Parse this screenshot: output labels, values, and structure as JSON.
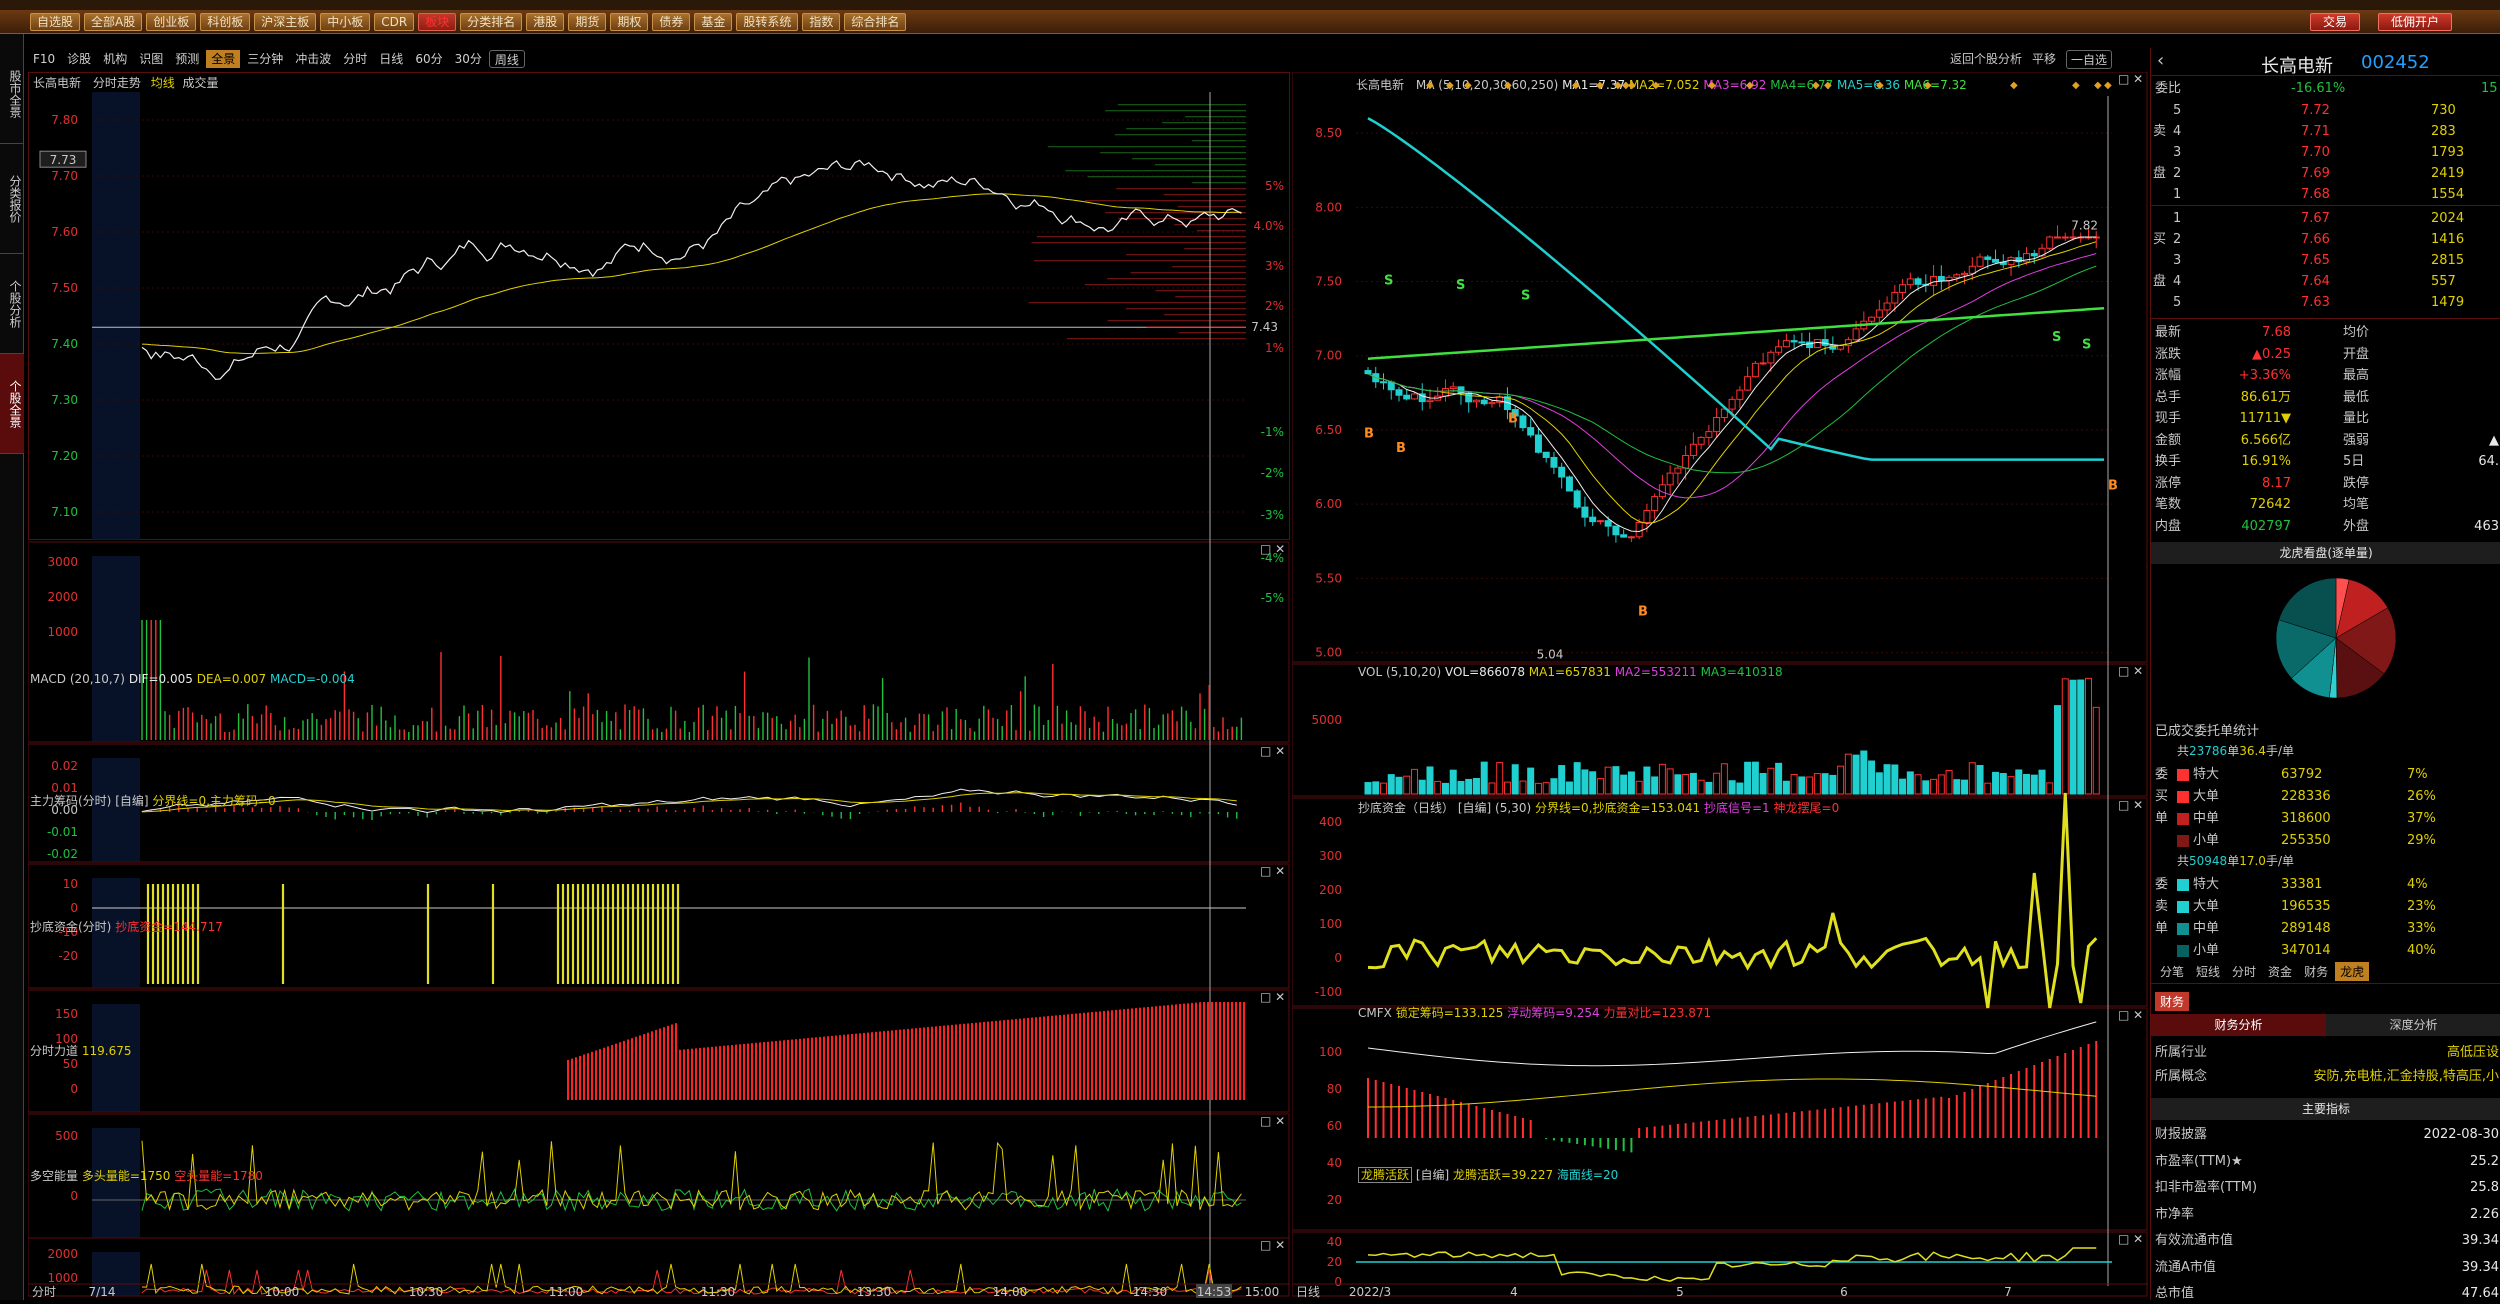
{
  "toolbar": {
    "buttons": [
      "自选股",
      "全部A股",
      "创业板",
      "科创板",
      "沪深主板",
      "中小板",
      "CDR",
      "板块",
      "分类排名",
      "港股",
      "期货",
      "期权",
      "债券",
      "基金",
      "股转系统",
      "指数",
      "综合排名"
    ],
    "trade": "交易",
    "open_account": "低佣开户"
  },
  "left_tabs": [
    "股市全景",
    "分类报价",
    "个股分析",
    "个股全景"
  ],
  "subbar": {
    "items": [
      "F10",
      "诊股",
      "机构",
      "识图",
      "预测",
      "全景",
      "三分钟",
      "冲击波",
      "分时",
      "日线",
      "60分",
      "30分",
      "周线"
    ],
    "active": "全景",
    "right_items": [
      "返回个股分析",
      "平移",
      "一自选"
    ]
  },
  "intraday": {
    "title": "长高电新",
    "subtitle": "分时走势",
    "avg_label": "均线",
    "vol_label": "成交量",
    "price_ticks": [
      "7.80",
      "7.70",
      "7.60",
      "7.50",
      "7.40",
      "7.30",
      "7.20",
      "7.10"
    ],
    "pct_ticks": [
      "5%",
      "4.0%",
      "3%",
      "2%",
      "1%",
      "-1%",
      "-2%",
      "-3%",
      "-4%",
      "-5%"
    ],
    "current_price_tag": "7.73",
    "mid_value": "7.43",
    "vol_ticks": [
      "3000",
      "2000",
      "1000"
    ],
    "macd_title": "MACD",
    "macd_params": "(20,10,7)",
    "macd_dif": "DIF=0.005",
    "macd_dea": "DEA=0.007",
    "macd_macd": "MACD=-0.004",
    "macd_ticks": [
      "0.02",
      "0.01",
      "0.00",
      "-0.01",
      "-0.02"
    ],
    "zl_title": "主力筹码(分时)",
    "zl_tag": "[自编]",
    "zl_values": "分界线=0,主力筹码=0",
    "zl_ticks": [
      "10",
      "0",
      "-10",
      "-20"
    ],
    "cd_title": "抄底资金(分时)",
    "cd_tag": "[自编]",
    "cd_value": "抄底资金=144.717",
    "cd_ticks": [
      "150",
      "100",
      "50",
      "0"
    ],
    "fs_title": "分时力道",
    "fs_value": "119.675",
    "fs_ticks": [
      "500",
      "0"
    ],
    "dk_title": "多空能量",
    "dk_value1": "多头量能=1750",
    "dk_value2": "空头量能=1780",
    "dk_ticks": [
      "2000",
      "1000"
    ],
    "time_labels": [
      "7/14",
      "10:00",
      "10:30",
      "11:00",
      "11:30",
      "13:30",
      "14:00",
      "14:30",
      "14:53",
      "15:00"
    ],
    "footer_left": "分时"
  },
  "daily": {
    "title": "长高电新",
    "ma_label": "MA",
    "ma_params": "(5,10,20,30,60,250)",
    "ma1": "MA1=7.37",
    "ma2": "MA2=7.052",
    "ma3": "MA3=6.92",
    "ma4": "MA4=6.77",
    "ma5": "MA5=6.36",
    "ma6": "MA6=7.32",
    "price_ticks": [
      "8.50",
      "8.00",
      "7.50",
      "7.00",
      "6.50",
      "6.00",
      "5.50",
      "5.00"
    ],
    "high_label": "7.82",
    "low_label": "5.04",
    "vol_title": "VOL",
    "vol_params": "(5,10,20)",
    "vol_value": "VOL=866078",
    "vol_ma1": "MA1=657831",
    "vol_ma2": "MA2=553211",
    "vol_ma3": "MA3=410318",
    "vol_ticks": [
      "5000"
    ],
    "cd_title": "抄底资金（日线）",
    "cd_tag": "[自编]",
    "cd_params": "(5,30)",
    "cd_values": "分界线=0,抄底资金=153.041",
    "cd_signal": "抄底信号=1",
    "cd_dragon": "神龙摆尾=0",
    "cd_ticks": [
      "400",
      "300",
      "200",
      "100",
      "0",
      "-100"
    ],
    "cmfx_title": "CMFX",
    "cmfx_lock": "锁定筹码=133.125",
    "cmfx_float": "浮动筹码=9.254",
    "cmfx_ratio": "力量对比=123.871",
    "cmfx_ticks": [
      "100",
      "80",
      "60",
      "40",
      "20"
    ],
    "lt_title": "龙腾活跃",
    "lt_tag": "[自编]",
    "lt_value": "龙腾活跃=39.227",
    "lt_sea": "海面线=20",
    "lt_ticks": [
      "40",
      "20",
      "0"
    ],
    "date_labels": [
      "2022/3",
      "4",
      "5",
      "6",
      "7"
    ],
    "footer_left": "日线"
  },
  "quote": {
    "name": "长高电新",
    "code": "002452",
    "wb_label": "委比",
    "wb_value": "-16.61%",
    "wb_extra": "15",
    "sell_side": "卖",
    "buy_side": "买",
    "pan": "盘",
    "sell": [
      {
        "lvl": "5",
        "price": "7.72",
        "vol": "730"
      },
      {
        "lvl": "4",
        "price": "7.71",
        "vol": "283"
      },
      {
        "lvl": "3",
        "price": "7.70",
        "vol": "1793"
      },
      {
        "lvl": "2",
        "price": "7.69",
        "vol": "2419"
      },
      {
        "lvl": "1",
        "price": "7.68",
        "vol": "1554"
      }
    ],
    "buy": [
      {
        "lvl": "1",
        "price": "7.67",
        "vol": "2024"
      },
      {
        "lvl": "2",
        "price": "7.66",
        "vol": "1416"
      },
      {
        "lvl": "3",
        "price": "7.65",
        "vol": "2815"
      },
      {
        "lvl": "4",
        "price": "7.64",
        "vol": "557"
      },
      {
        "lvl": "5",
        "price": "7.63",
        "vol": "1479"
      }
    ],
    "stats": [
      {
        "k1": "最新",
        "v1": "7.68",
        "k2": "均价",
        "v2": "",
        "c1": "red"
      },
      {
        "k1": "涨跌",
        "v1": "▲0.25",
        "k2": "开盘",
        "v2": "",
        "c1": "red"
      },
      {
        "k1": "涨幅",
        "v1": "+3.36%",
        "k2": "最高",
        "v2": "",
        "c1": "red"
      },
      {
        "k1": "总手",
        "v1": "86.61万",
        "k2": "最低",
        "v2": "",
        "c1": "yellow"
      },
      {
        "k1": "现手",
        "v1": "11711▼",
        "k2": "量比",
        "v2": "",
        "c1": "yellow"
      },
      {
        "k1": "金额",
        "v1": "6.566亿",
        "k2": "强弱",
        "v2": "▲",
        "c1": "yellow"
      },
      {
        "k1": "换手",
        "v1": "16.91%",
        "k2": "5日",
        "v2": "64.",
        "c1": "yellow"
      },
      {
        "k1": "涨停",
        "v1": "8.17",
        "k2": "跌停",
        "v2": "",
        "c1": "red"
      },
      {
        "k1": "笔数",
        "v1": "72642",
        "k2": "均笔",
        "v2": "",
        "c1": "yellow"
      },
      {
        "k1": "内盘",
        "v1": "402797",
        "k2": "外盘",
        "v2": "463",
        "c1": "green"
      }
    ],
    "pie_title": "龙虎看盘(逐单量)",
    "order_title": "已成交委托单统计",
    "buy_group_head_a": "共",
    "buy_group_count": "23786",
    "buy_group_head_b": "单",
    "buy_group_avg": "36.4",
    "buy_group_unit": "手/单",
    "sell_group_count": "50948",
    "sell_group_avg": "17.0",
    "buy_side_label": [
      "委",
      "买",
      "单"
    ],
    "sell_side_label": [
      "委",
      "卖",
      "单"
    ],
    "buy_orders": [
      {
        "name": "特大",
        "vol": "63792",
        "pct": "7%"
      },
      {
        "name": "大单",
        "vol": "228336",
        "pct": "26%"
      },
      {
        "name": "中单",
        "vol": "318600",
        "pct": "37%"
      },
      {
        "name": "小单",
        "vol": "255350",
        "pct": "29%"
      }
    ],
    "sell_orders": [
      {
        "name": "特大",
        "vol": "33381",
        "pct": "4%"
      },
      {
        "name": "大单",
        "vol": "196535",
        "pct": "23%"
      },
      {
        "name": "中单",
        "vol": "289148",
        "pct": "33%"
      },
      {
        "name": "小单",
        "vol": "347014",
        "pct": "40%"
      }
    ],
    "tabs": [
      "分笔",
      "短线",
      "分时",
      "资金",
      "财务",
      "龙虎"
    ],
    "active_tab": "龙虎",
    "fin_tab": "财务",
    "fin_sub": [
      "财务分析",
      "深度分析"
    ],
    "info": [
      {
        "k": "所属行业",
        "v": "高低压设"
      },
      {
        "k": "所属概念",
        "v": "安防,充电桩,汇金持股,特高压,小"
      }
    ],
    "key_title": "主要指标",
    "metrics": [
      {
        "k": "财报披露",
        "v": "2022-08-30"
      },
      {
        "k": "市盈率(TTM)★",
        "v": "25.2"
      },
      {
        "k": "扣非市盈率(TTM)",
        "v": "25.8"
      },
      {
        "k": "市净率",
        "v": "2.26"
      },
      {
        "k": "有效流通市值",
        "v": "39.34"
      },
      {
        "k": "流通A市值",
        "v": "39.34"
      },
      {
        "k": "总市值",
        "v": "47.64"
      }
    ]
  },
  "colors": {
    "up": "#ff3030",
    "down": "#20d0d0",
    "border": "#5a0e0e",
    "accent": "#c08020"
  }
}
